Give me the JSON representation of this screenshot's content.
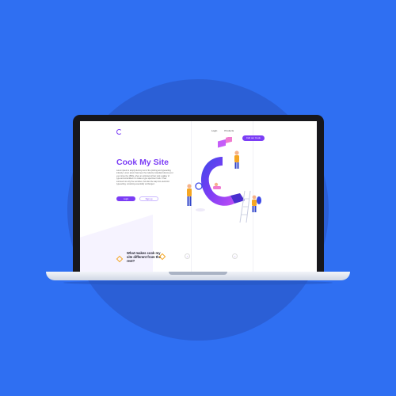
{
  "nav": {
    "links": [
      "Login",
      "Products"
    ],
    "cta": "Call our Cook"
  },
  "hero": {
    "title": "Cook My Site",
    "body": "Lorem ipsum is simply dummy text of the printing and typesetting industry. Lorem ipsum has been the industry's standard dummy text ever since the 1500s, when an unknown printer took a galley of type and scrambled it to make a type specimen book. It has survived not only five centuries, but also the leap into electronic typesetting, remaining essentially unchanged.",
    "primary_button": "Login",
    "secondary_button": "Sign up"
  },
  "features": {
    "title": "What makes cook my site different from the rest?"
  },
  "colors": {
    "background": "#2f6ff2",
    "accent": "#7b3df5",
    "secondary_accent": "#f5a623"
  },
  "icons": {
    "logo": "c-logo-icon",
    "feature_1": "hexagon-icon",
    "feature_2": "hexagon-icon",
    "feature_3": "gender-icon",
    "feature_4": "gender-icon"
  }
}
